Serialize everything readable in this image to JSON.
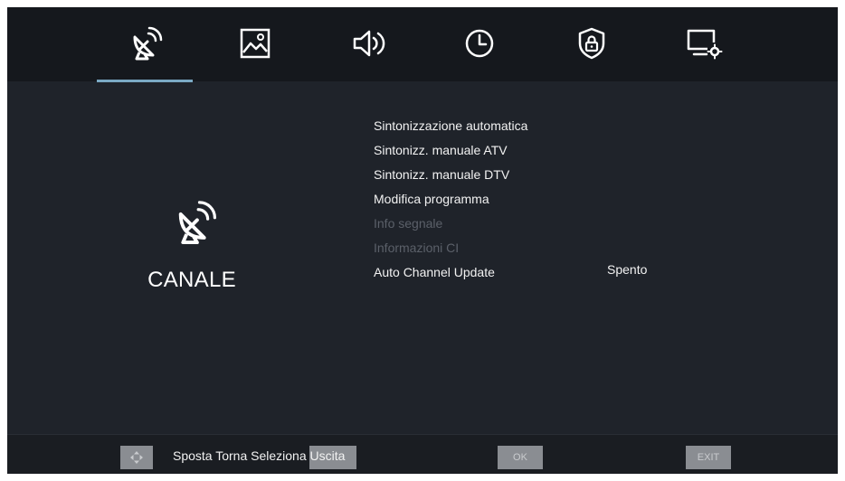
{
  "tabs": [
    {
      "icon": "satellite-dish-icon",
      "active": true
    },
    {
      "icon": "picture-icon",
      "active": false
    },
    {
      "icon": "speaker-icon",
      "active": false
    },
    {
      "icon": "clock-icon",
      "active": false
    },
    {
      "icon": "lock-shield-icon",
      "active": false
    },
    {
      "icon": "monitor-settings-icon",
      "active": false
    }
  ],
  "category": {
    "icon": "satellite-dish-icon",
    "title": "CANALE"
  },
  "menu": {
    "items": [
      {
        "label": "Sintonizzazione automatica",
        "enabled": true
      },
      {
        "label": "Sintonizz. manuale ATV",
        "enabled": true
      },
      {
        "label": "Sintonizz. manuale DTV",
        "enabled": true
      },
      {
        "label": "Modifica programma",
        "enabled": true
      },
      {
        "label": "Info segnale",
        "enabled": false
      },
      {
        "label": "Informazioni CI",
        "enabled": false
      },
      {
        "label": "Auto Channel Update",
        "enabled": true
      }
    ],
    "auto_update_value": "Spento"
  },
  "footer": {
    "hint": "Sposta Torna Seleziona Uscita",
    "ok_key": "OK",
    "exit_key": "EXIT"
  },
  "colors": {
    "background": "#1f232a",
    "topbar": "#15181d",
    "accent": "#7aa9c4",
    "text": "#f2f2f2",
    "disabled_text": "#5b6069"
  }
}
